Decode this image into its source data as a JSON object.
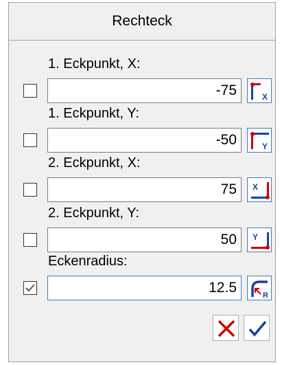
{
  "dialog": {
    "title": "Rechteck"
  },
  "fields": [
    {
      "label": "1. Eckpunkt, X:",
      "value": "-75",
      "checked": false,
      "icon": "corner-top-left-x-icon"
    },
    {
      "label": "1. Eckpunkt, Y:",
      "value": "-50",
      "checked": false,
      "icon": "corner-top-left-y-icon"
    },
    {
      "label": "2. Eckpunkt, X:",
      "value": "75",
      "checked": false,
      "icon": "corner-bottom-right-x-icon"
    },
    {
      "label": "2. Eckpunkt, Y:",
      "value": "50",
      "checked": false,
      "icon": "corner-bottom-right-y-icon"
    },
    {
      "label": "Eckenradius:",
      "value": "12.5",
      "checked": true,
      "icon": "corner-radius-icon"
    }
  ],
  "pick_letters": [
    "X",
    "Y",
    "X",
    "Y",
    "R"
  ],
  "actions": {
    "cancel_icon": "cancel-x-icon",
    "ok_icon": "ok-check-icon"
  },
  "colors": {
    "icon_red": "#cc0000",
    "icon_blue": "#1a3f9e",
    "focus_border": "#3c7fb1"
  }
}
